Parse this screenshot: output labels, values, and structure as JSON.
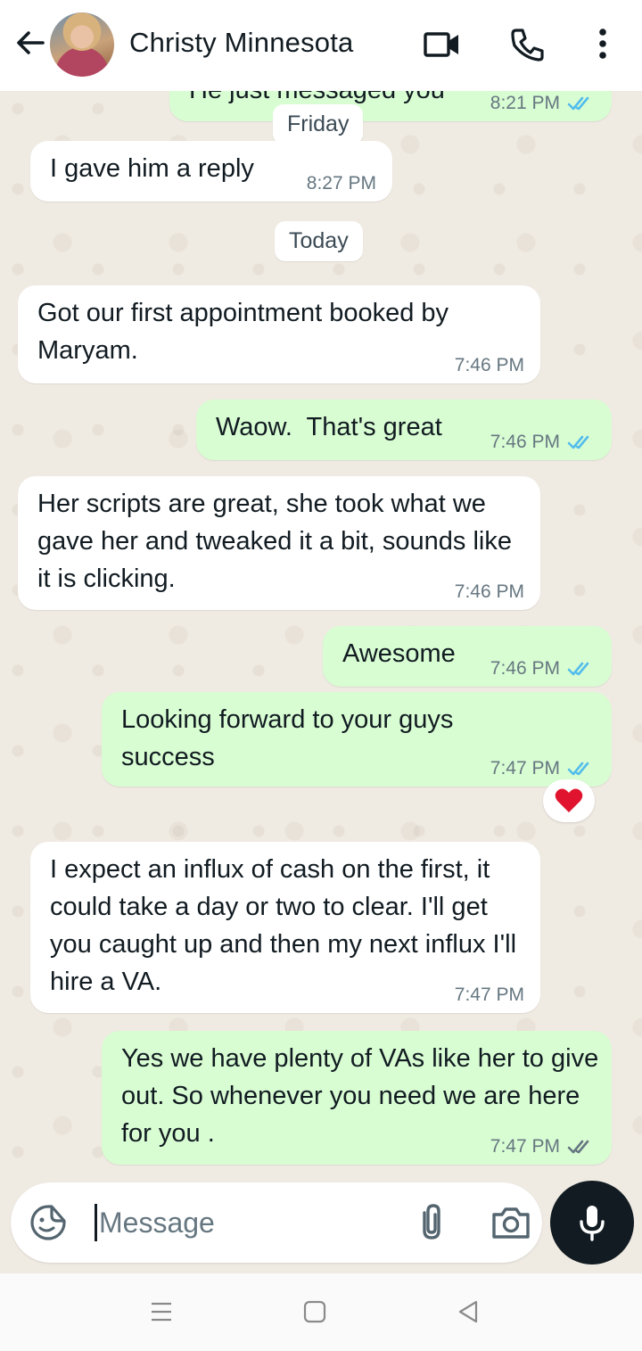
{
  "header": {
    "contact_name": "Christy Minnesota"
  },
  "chat": {
    "partial_top": {
      "text": "He just messaged you",
      "time": "8:21 PM"
    },
    "date_friday": "Friday",
    "date_today": "Today",
    "messages": [
      {
        "dir": "in",
        "text": "I gave him a reply",
        "time": "8:27 PM"
      },
      {
        "dir": "in",
        "text": "Got our first appointment booked by Maryam.",
        "time": "7:46 PM"
      },
      {
        "dir": "out",
        "text": "Waow.  That's great",
        "time": "7:46 PM",
        "status": "read"
      },
      {
        "dir": "in",
        "text": "Her scripts are great, she took what we gave her and tweaked it a bit, sounds like it is clicking.",
        "time": "7:46 PM"
      },
      {
        "dir": "out",
        "text": "Awesome",
        "time": "7:46 PM",
        "status": "read"
      },
      {
        "dir": "out",
        "text": "Looking forward to your guys success",
        "time": "7:47 PM",
        "status": "read",
        "reaction": "❤"
      },
      {
        "dir": "in",
        "text": "I expect an influx of cash on the first, it could take a day or two to clear. I'll get you caught up and then my next influx I'll hire a VA.",
        "time": "7:47 PM"
      },
      {
        "dir": "out",
        "text": "Yes we have plenty of VAs like her to give out. So whenever you need we are here for you .",
        "time": "7:47 PM",
        "status": "delivered"
      }
    ]
  },
  "composer": {
    "placeholder": "Message"
  },
  "colors": {
    "outgoing_bubble": "#d9fdd3",
    "incoming_bubble": "#ffffff",
    "read_tick": "#53bdeb",
    "delivered_tick": "#667781",
    "mic_button": "#111b21"
  },
  "icons": [
    "back-arrow-icon",
    "video-call-icon",
    "phone-icon",
    "more-vert-icon",
    "sticker-icon",
    "attach-icon",
    "camera-icon",
    "mic-icon",
    "nav-recents-icon",
    "nav-home-icon",
    "nav-back-icon"
  ]
}
